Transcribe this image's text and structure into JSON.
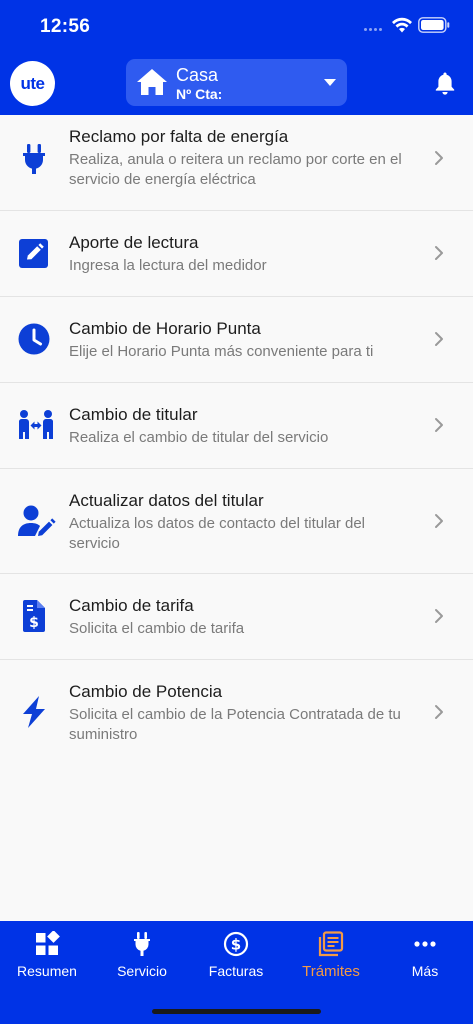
{
  "status": {
    "time": "12:56"
  },
  "header": {
    "logo_text": "ute",
    "account_name": "Casa",
    "account_number": "Nº Cta:"
  },
  "items": [
    {
      "title": "Reclamo por falta de energía",
      "desc": "Realiza, anula o reitera un reclamo por corte en el servicio de energía eléctrica",
      "icon": "plug-icon"
    },
    {
      "title": "Aporte de lectura",
      "desc": "Ingresa la lectura del medidor",
      "icon": "edit-icon"
    },
    {
      "title": "Cambio de Horario Punta",
      "desc": "Elije el Horario Punta más conveniente para ti",
      "icon": "clock-icon"
    },
    {
      "title": "Cambio de titular",
      "desc": "Realiza el cambio de titular del servicio",
      "icon": "people-transfer-icon"
    },
    {
      "title": "Actualizar datos del titular",
      "desc": "Actualiza los datos de contacto del titular del servicio",
      "icon": "user-edit-icon"
    },
    {
      "title": "Cambio de tarifa",
      "desc": "Solicita el cambio de tarifa",
      "icon": "invoice-dollar-icon"
    },
    {
      "title": "Cambio de Potencia",
      "desc": "Solicita el cambio de la Potencia Contratada de tu suministro",
      "icon": "bolt-icon"
    }
  ],
  "tabs": [
    {
      "label": "Resumen",
      "icon": "dashboard-icon"
    },
    {
      "label": "Servicio",
      "icon": "plug-icon"
    },
    {
      "label": "Facturas",
      "icon": "dollar-circle-icon"
    },
    {
      "label": "Trámites",
      "icon": "documents-icon",
      "active": true
    },
    {
      "label": "Más",
      "icon": "more-icon"
    }
  ],
  "colors": {
    "primary": "#0033e6",
    "active_tab": "#f29a46",
    "icon_blue": "#0d3fd6"
  }
}
